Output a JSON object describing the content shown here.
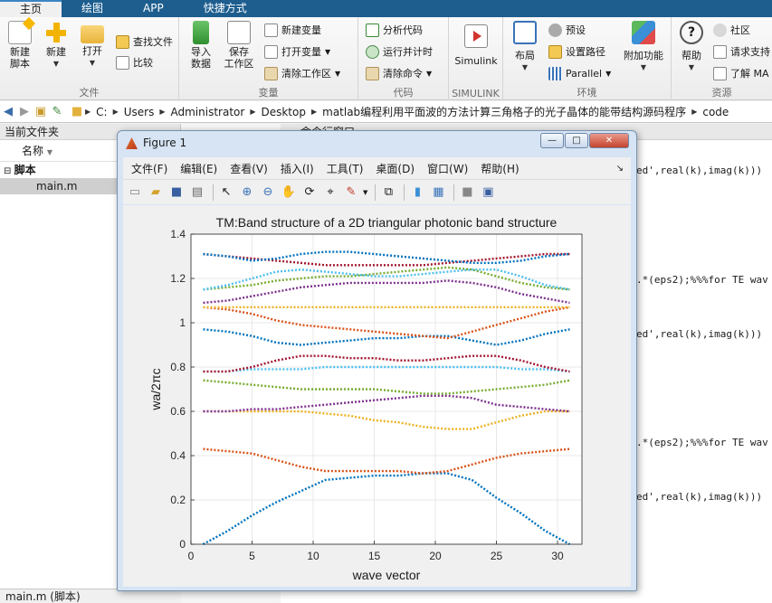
{
  "tabs": [
    {
      "label": "主页",
      "active": true
    },
    {
      "label": "绘图",
      "active": false
    },
    {
      "label": "APP",
      "active": false
    },
    {
      "label": "快捷方式",
      "active": false
    }
  ],
  "ribbon": {
    "file": {
      "label": "文件",
      "new_script": "新建\n脚本",
      "new": "新建",
      "open": "打开",
      "find_files": "查找文件",
      "compare": "比较"
    },
    "variable": {
      "label": "变量",
      "import": "导入\n数据",
      "save_ws": "保存\n工作区",
      "new_var": "新建变量",
      "open_var": "打开变量",
      "clear_ws": "清除工作区"
    },
    "code": {
      "label": "代码",
      "analyze": "分析代码",
      "run_time": "运行并计时",
      "clear_cmd": "清除命令"
    },
    "simulink": {
      "label": "SIMULINK",
      "simulink": "Simulink"
    },
    "env": {
      "label": "环境",
      "layout": "布局",
      "prefs": "预设",
      "set_path": "设置路径",
      "parallel": "Parallel",
      "addons": "附加功能"
    },
    "resources": {
      "label": "资源",
      "help": "帮助",
      "community": "社区",
      "request_support": "请求支持",
      "learn": "了解 MA"
    }
  },
  "address": {
    "crumbs": [
      "C:",
      "Users",
      "Administrator",
      "Desktop",
      "matlab编程利用平面波的方法计算三角格子的光子晶体的能带结构源码程序",
      "code"
    ]
  },
  "left_panel": {
    "title": "当前文件夹",
    "column": "名称",
    "root": "脚本",
    "file": "main.m",
    "status": "main.m  (脚本)"
  },
  "command_window": {
    "title": "命令行窗口",
    "lines": [
      "ed',real(k),imag(k)))",
      ".*(eps2);%%%for TE wav",
      "ed',real(k),imag(k)))",
      ".*(eps2);%%%for TE wav",
      "ed',real(k),imag(k)))"
    ]
  },
  "figure": {
    "title": "Figure 1",
    "menus": [
      "文件(F)",
      "编辑(E)",
      "查看(V)",
      "插入(I)",
      "工具(T)",
      "桌面(D)",
      "窗口(W)",
      "帮助(H)"
    ],
    "window_buttons": [
      "—",
      "□",
      "✕"
    ]
  },
  "chart_data": {
    "type": "line",
    "title": "TM:Band structure of a 2D triangular photonic band structure",
    "xlabel": "wave vector",
    "ylabel": "wa/2πc",
    "xlim": [
      0,
      32
    ],
    "ylim": [
      0,
      1.4
    ],
    "xticks": [
      0,
      5,
      10,
      15,
      20,
      25,
      30
    ],
    "yticks": [
      0,
      0.2,
      0.4,
      0.6,
      0.8,
      1,
      1.2,
      1.4
    ],
    "ytick_labels": [
      "0",
      "0.2",
      "0.4",
      "0.6",
      "0.8",
      "1",
      "1.2",
      "1.4"
    ],
    "grid": true,
    "style": "dotted",
    "x": [
      1,
      3,
      5,
      7,
      9,
      11,
      13,
      15,
      17,
      19,
      21,
      23,
      25,
      27,
      29,
      31
    ],
    "series": [
      {
        "color": "#0072bd",
        "values": [
          0.0,
          0.06,
          0.13,
          0.19,
          0.24,
          0.29,
          0.3,
          0.31,
          0.31,
          0.32,
          0.32,
          0.29,
          0.21,
          0.14,
          0.06,
          0.0
        ]
      },
      {
        "color": "#d95319",
        "values": [
          0.43,
          0.42,
          0.41,
          0.38,
          0.35,
          0.33,
          0.33,
          0.33,
          0.33,
          0.32,
          0.33,
          0.36,
          0.39,
          0.41,
          0.42,
          0.43
        ]
      },
      {
        "color": "#edb120",
        "values": [
          0.6,
          0.6,
          0.6,
          0.6,
          0.6,
          0.59,
          0.58,
          0.56,
          0.55,
          0.53,
          0.52,
          0.52,
          0.55,
          0.58,
          0.6,
          0.6
        ]
      },
      {
        "color": "#7e2f8e",
        "values": [
          0.6,
          0.6,
          0.61,
          0.61,
          0.62,
          0.63,
          0.64,
          0.65,
          0.66,
          0.67,
          0.67,
          0.66,
          0.63,
          0.62,
          0.61,
          0.6
        ]
      },
      {
        "color": "#77ac30",
        "values": [
          0.74,
          0.73,
          0.72,
          0.71,
          0.7,
          0.7,
          0.7,
          0.7,
          0.69,
          0.68,
          0.68,
          0.69,
          0.7,
          0.71,
          0.72,
          0.74
        ]
      },
      {
        "color": "#4dbeee",
        "values": [
          0.78,
          0.78,
          0.79,
          0.79,
          0.79,
          0.8,
          0.8,
          0.8,
          0.8,
          0.8,
          0.8,
          0.8,
          0.8,
          0.79,
          0.79,
          0.78
        ]
      },
      {
        "color": "#a2142f",
        "values": [
          0.78,
          0.78,
          0.8,
          0.83,
          0.85,
          0.85,
          0.84,
          0.84,
          0.83,
          0.83,
          0.84,
          0.85,
          0.85,
          0.83,
          0.8,
          0.78
        ]
      },
      {
        "color": "#0072bd",
        "values": [
          0.97,
          0.96,
          0.94,
          0.91,
          0.9,
          0.91,
          0.92,
          0.93,
          0.93,
          0.94,
          0.94,
          0.92,
          0.9,
          0.92,
          0.95,
          0.97
        ]
      },
      {
        "color": "#d95319",
        "values": [
          1.07,
          1.06,
          1.04,
          1.01,
          0.99,
          0.98,
          0.97,
          0.96,
          0.95,
          0.94,
          0.93,
          0.96,
          0.99,
          1.02,
          1.05,
          1.07
        ]
      },
      {
        "color": "#edb120",
        "values": [
          1.07,
          1.07,
          1.07,
          1.07,
          1.07,
          1.07,
          1.07,
          1.07,
          1.07,
          1.07,
          1.07,
          1.07,
          1.07,
          1.07,
          1.07,
          1.07
        ]
      },
      {
        "color": "#7e2f8e",
        "values": [
          1.09,
          1.1,
          1.12,
          1.14,
          1.16,
          1.17,
          1.18,
          1.18,
          1.18,
          1.18,
          1.19,
          1.18,
          1.16,
          1.13,
          1.11,
          1.09
        ]
      },
      {
        "color": "#77ac30",
        "values": [
          1.15,
          1.16,
          1.17,
          1.19,
          1.2,
          1.21,
          1.21,
          1.22,
          1.23,
          1.24,
          1.25,
          1.24,
          1.21,
          1.18,
          1.16,
          1.15
        ]
      },
      {
        "color": "#4dbeee",
        "values": [
          1.15,
          1.17,
          1.2,
          1.23,
          1.24,
          1.23,
          1.22,
          1.21,
          1.21,
          1.22,
          1.23,
          1.24,
          1.24,
          1.21,
          1.17,
          1.15
        ]
      },
      {
        "color": "#a2142f",
        "values": [
          1.31,
          1.3,
          1.29,
          1.28,
          1.27,
          1.26,
          1.26,
          1.26,
          1.26,
          1.26,
          1.27,
          1.28,
          1.29,
          1.3,
          1.31,
          1.31
        ]
      },
      {
        "color": "#0072bd",
        "values": [
          1.31,
          1.3,
          1.28,
          1.29,
          1.31,
          1.32,
          1.32,
          1.31,
          1.3,
          1.29,
          1.28,
          1.27,
          1.27,
          1.28,
          1.3,
          1.31
        ]
      }
    ]
  }
}
